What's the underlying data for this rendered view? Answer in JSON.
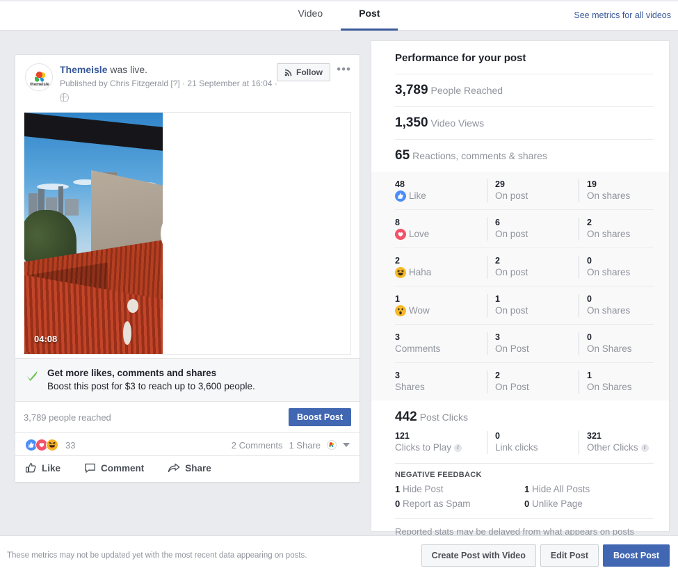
{
  "topbar": {
    "tabs": [
      {
        "label": "Video",
        "active": false
      },
      {
        "label": "Post",
        "active": true
      }
    ],
    "see_metrics_link": "See metrics for all videos"
  },
  "post": {
    "page_name": "Themeisle",
    "action_text": " was live.",
    "published_by": "Published by Chris Fitzgerald [?] · 21 September at 16:04 ·",
    "privacy_icon": "globe-icon",
    "follow_label": "Follow",
    "follow_icon": "rss-icon",
    "more_icon": "ellipsis-icon",
    "video": {
      "duration": "04:08",
      "play_icon": "play-icon"
    },
    "promo": {
      "check_icon": "green-check-icon",
      "title": "Get more likes, comments and shares",
      "subtitle": "Boost this post for $3 to reach up to 3,600 people."
    },
    "reach": {
      "text": "3,789 people reached",
      "boost_label": "Boost Post"
    },
    "reactions_bar": {
      "count": "33",
      "comments": "2 Comments",
      "shares": "1 Share"
    },
    "actions": [
      {
        "label": "Like",
        "icon": "thumbs-up-icon"
      },
      {
        "label": "Comment",
        "icon": "comment-bubble-icon"
      },
      {
        "label": "Share",
        "icon": "share-arrow-icon"
      }
    ]
  },
  "performance": {
    "title": "Performance for your post",
    "summary": [
      {
        "value": "3,789",
        "label": "People Reached"
      },
      {
        "value": "1,350",
        "label": "Video Views"
      },
      {
        "value": "65",
        "label": "Reactions, comments & shares"
      }
    ],
    "reaction_rows": [
      {
        "total": "48",
        "label": "Like",
        "icon": "like-icon",
        "on_post_value": "29",
        "on_post_label": "On post",
        "on_shares_value": "19",
        "on_shares_label": "On shares"
      },
      {
        "total": "8",
        "label": "Love",
        "icon": "love-icon",
        "on_post_value": "6",
        "on_post_label": "On post",
        "on_shares_value": "2",
        "on_shares_label": "On shares"
      },
      {
        "total": "2",
        "label": "Haha",
        "icon": "haha-icon",
        "on_post_value": "2",
        "on_post_label": "On post",
        "on_shares_value": "0",
        "on_shares_label": "On shares"
      },
      {
        "total": "1",
        "label": "Wow",
        "icon": "wow-icon",
        "on_post_value": "1",
        "on_post_label": "On post",
        "on_shares_value": "0",
        "on_shares_label": "On shares"
      },
      {
        "total": "3",
        "label": "Comments",
        "icon": "",
        "on_post_value": "3",
        "on_post_label": "On Post",
        "on_shares_value": "0",
        "on_shares_label": "On Shares"
      },
      {
        "total": "3",
        "label": "Shares",
        "icon": "",
        "on_post_value": "2",
        "on_post_label": "On Post",
        "on_shares_value": "1",
        "on_shares_label": "On Shares"
      }
    ],
    "post_clicks": {
      "value": "442",
      "label": "Post Clicks"
    },
    "click_cells": [
      {
        "value": "121",
        "label": "Clicks to Play",
        "info": true
      },
      {
        "value": "0",
        "label": "Link clicks",
        "info": false
      },
      {
        "value": "321",
        "label": "Other Clicks",
        "info": true
      }
    ],
    "negative_feedback_title": "NEGATIVE FEEDBACK",
    "negative_feedback": [
      {
        "value": "1",
        "label": "Hide Post"
      },
      {
        "value": "1",
        "label": "Hide All Posts"
      },
      {
        "value": "0",
        "label": "Report as Spam"
      },
      {
        "value": "0",
        "label": "Unlike Page"
      }
    ],
    "footnote": "Reported stats may be delayed from what appears on posts"
  },
  "footer": {
    "note": "These metrics may not be updated yet with the most recent data appearing on posts.",
    "buttons": [
      {
        "label": "Create Post with Video",
        "primary": false
      },
      {
        "label": "Edit Post",
        "primary": false
      },
      {
        "label": "Boost Post",
        "primary": true
      }
    ]
  },
  "colors": {
    "accent_blue": "#4267b2",
    "link_blue": "#385898",
    "tab_underline": "#3b5998",
    "page_bg": "#e9ebee",
    "muted_text": "#90949c"
  }
}
